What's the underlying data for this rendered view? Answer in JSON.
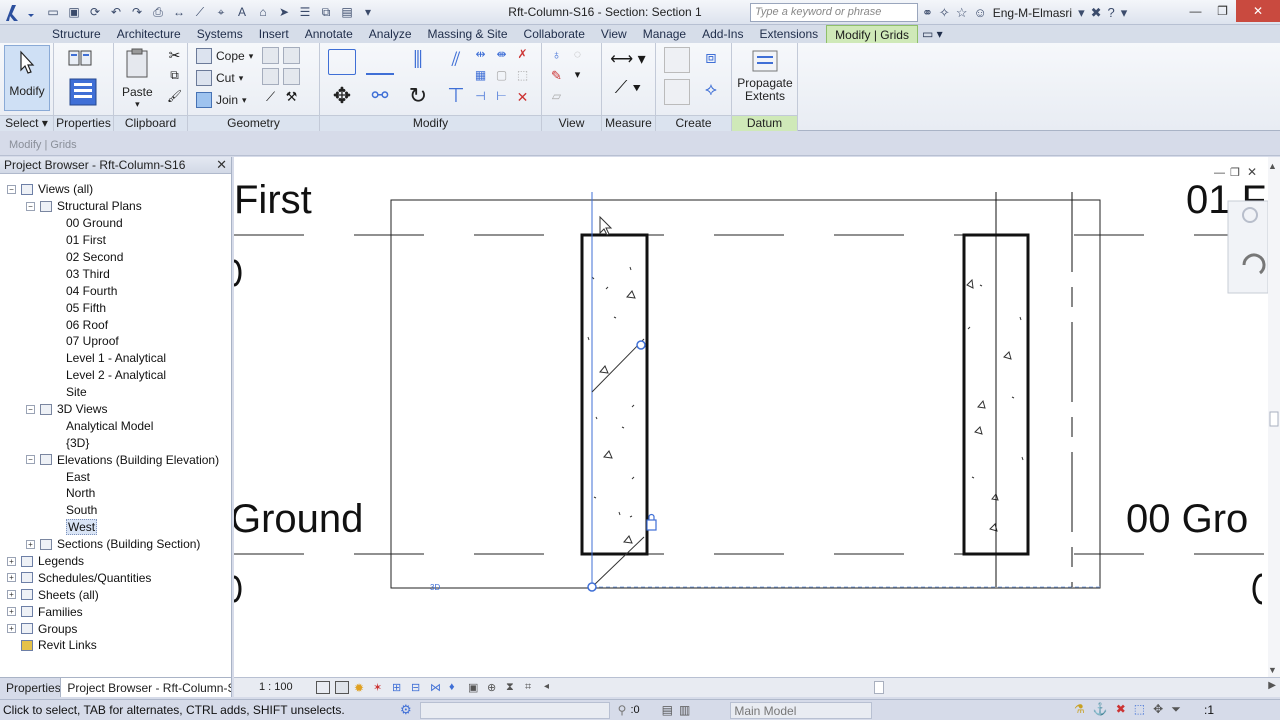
{
  "window": {
    "doc_title": "Rft-Column-S16 - Section: Section 1",
    "search_placeholder": "Type a keyword or phrase",
    "user": "Eng-M-Elmasri"
  },
  "ribbon": {
    "tabs": [
      {
        "label": "Structure"
      },
      {
        "label": "Architecture"
      },
      {
        "label": "Systems"
      },
      {
        "label": "Insert"
      },
      {
        "label": "Annotate"
      },
      {
        "label": "Analyze"
      },
      {
        "label": "Massing & Site"
      },
      {
        "label": "Collaborate"
      },
      {
        "label": "View"
      },
      {
        "label": "Manage"
      },
      {
        "label": "Add-Ins"
      },
      {
        "label": "Extensions"
      },
      {
        "label": "Modify | Grids",
        "active": true
      }
    ],
    "modify_label": "Modify",
    "properties_label": "Properties",
    "paste_label": "Paste",
    "cope_label": "Cope",
    "cut_label": "Cut",
    "join_label": "Join",
    "propagate_label_1": "Propagate",
    "propagate_label_2": "Extents",
    "panels": {
      "select": "Select",
      "properties": "Properties",
      "clipboard": "Clipboard",
      "geometry": "Geometry",
      "modify": "Modify",
      "view": "View",
      "measure": "Measure",
      "create": "Create",
      "datum": "Datum"
    }
  },
  "options_bar": {
    "context": "Modify | Grids"
  },
  "project_browser": {
    "title": "Project Browser - Rft-Column-S16",
    "items": [
      {
        "label": "Views (all)",
        "level": 0,
        "toggle": "−"
      },
      {
        "label": "Structural Plans",
        "level": 1,
        "toggle": "−"
      },
      {
        "label": "00 Ground",
        "level": 2
      },
      {
        "label": "01 First",
        "level": 2
      },
      {
        "label": "02 Second",
        "level": 2
      },
      {
        "label": "03 Third",
        "level": 2
      },
      {
        "label": "04 Fourth",
        "level": 2
      },
      {
        "label": "05 Fifth",
        "level": 2
      },
      {
        "label": "06 Roof",
        "level": 2
      },
      {
        "label": "07 Uproof",
        "level": 2
      },
      {
        "label": "Level 1 - Analytical",
        "level": 2
      },
      {
        "label": "Level 2 - Analytical",
        "level": 2
      },
      {
        "label": "Site",
        "level": 2
      },
      {
        "label": "3D Views",
        "level": 1,
        "toggle": "−"
      },
      {
        "label": "Analytical Model",
        "level": 2
      },
      {
        "label": "{3D}",
        "level": 2
      },
      {
        "label": "Elevations (Building Elevation)",
        "level": 1,
        "toggle": "−"
      },
      {
        "label": "East",
        "level": 2
      },
      {
        "label": "North",
        "level": 2
      },
      {
        "label": "South",
        "level": 2
      },
      {
        "label": "West",
        "level": 2,
        "selected": true
      },
      {
        "label": "Sections (Building Section)",
        "level": 1,
        "toggle": "+"
      },
      {
        "label": "Legends",
        "level": 0,
        "toggle": "+"
      },
      {
        "label": "Schedules/Quantities",
        "level": 0,
        "toggle": "+"
      },
      {
        "label": "Sheets (all)",
        "level": 0,
        "toggle": "+"
      },
      {
        "label": "Families",
        "level": 0,
        "toggle": "+"
      },
      {
        "label": "Groups",
        "level": 0,
        "toggle": "+"
      },
      {
        "label": "Revit Links",
        "level": 0
      }
    ],
    "tabs": [
      {
        "label": "Properties"
      },
      {
        "label": "Project Browser - Rft-Column-S...",
        "active": true
      }
    ]
  },
  "canvas": {
    "level_left_top": "First",
    "level_left_bottom": "Ground",
    "level_right_top": "01 F",
    "level_right_bottom": "00 Gro",
    "tag_3d": "3D"
  },
  "view_control": {
    "scale": "1 : 100"
  },
  "status": {
    "hint": "Click to select, TAB for alternates, CTRL adds, SHIFT unselects.",
    "zero": ":0",
    "model": "Main Model",
    "filter_count": ":1"
  },
  "colors": {
    "active_tab": "#cfe9b8",
    "selection_blue": "#3f6fd6",
    "close_button": "#c94a3f"
  }
}
